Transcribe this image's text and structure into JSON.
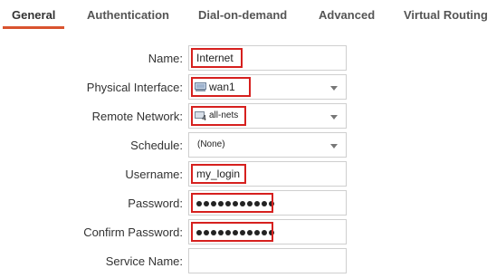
{
  "tabs": [
    {
      "label": "General",
      "active": true
    },
    {
      "label": "Authentication"
    },
    {
      "label": "Dial-on-demand"
    },
    {
      "label": "Advanced"
    },
    {
      "label": "Virtual Routing"
    }
  ],
  "form": {
    "name": {
      "label": "Name:",
      "value": "Internet"
    },
    "physical_interface": {
      "label": "Physical Interface:",
      "value": "wan1",
      "icon": "network-interface-icon"
    },
    "remote_network": {
      "label": "Remote Network:",
      "value": "all-nets",
      "icon": "network-object-icon"
    },
    "schedule": {
      "label": "Schedule:",
      "value": "(None)"
    },
    "username": {
      "label": "Username:",
      "value": "my_login"
    },
    "password": {
      "label": "Password:",
      "masked_length": 11
    },
    "confirm_password": {
      "label": "Confirm Password:",
      "masked_length": 11
    },
    "service_name": {
      "label": "Service Name:",
      "value": ""
    }
  },
  "colors": {
    "accent_tab_underline": "#d9532f",
    "highlight_box": "#d6201e"
  }
}
